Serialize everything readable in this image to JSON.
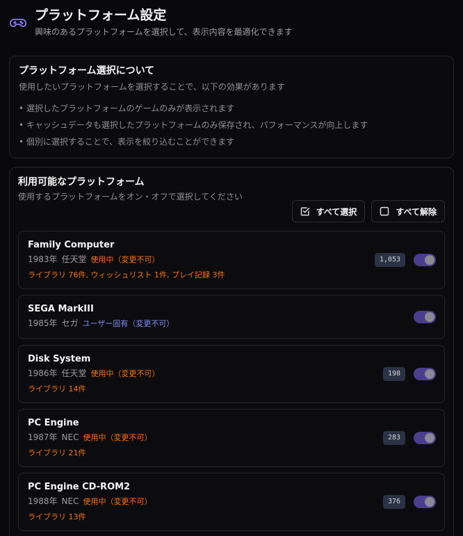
{
  "header": {
    "title": "プラットフォーム設定",
    "subtitle": "興味のあるプラットフォームを選択して、表示内容を最適化できます"
  },
  "about": {
    "title": "プラットフォーム選択について",
    "description": "使用したいプラットフォームを選択することで、以下の効果があります",
    "bullets": [
      "選択したプラットフォームのゲームのみが表示されます",
      "キャッシュデータも選択したプラットフォームのみ保存され、パフォーマンスが向上します",
      "個別に選択することで、表示を絞り込むことができます"
    ]
  },
  "platforms": {
    "title": "利用可能なプラットフォーム",
    "description": "使用するプラットフォームをオン・オフで選択してください",
    "select_all_label": "すべて選択",
    "deselect_all_label": "すべて解除",
    "items": [
      {
        "name": "Family Computer",
        "year": "1983年",
        "maker": "任天堂",
        "tag": "使用中（変更不可）",
        "tag_type": "orange",
        "stats": "ライブラリ 76件, ウィッシュリスト 1件, プレイ記録 3件",
        "count": "1,053",
        "enabled": true
      },
      {
        "name": "SEGA MarkIII",
        "year": "1985年",
        "maker": "セガ",
        "tag": "ユーザー固有（変更不可）",
        "tag_type": "purple",
        "stats": "",
        "count": "",
        "enabled": true
      },
      {
        "name": "Disk System",
        "year": "1986年",
        "maker": "任天堂",
        "tag": "使用中（変更不可）",
        "tag_type": "orange",
        "stats": "ライブラリ 14件",
        "count": "198",
        "enabled": true
      },
      {
        "name": "PC Engine",
        "year": "1987年",
        "maker": "NEC",
        "tag": "使用中（変更不可）",
        "tag_type": "orange",
        "stats": "ライブラリ 21件",
        "count": "283",
        "enabled": true
      },
      {
        "name": "PC Engine CD-ROM2",
        "year": "1988年",
        "maker": "NEC",
        "tag": "使用中（変更不可）",
        "tag_type": "orange",
        "stats": "ライブラリ 13件",
        "count": "376",
        "enabled": true
      }
    ]
  },
  "colors": {
    "accent_orange": "#f97316",
    "accent_purple": "#818cf8",
    "toggle_on": "#4c3d8f"
  }
}
